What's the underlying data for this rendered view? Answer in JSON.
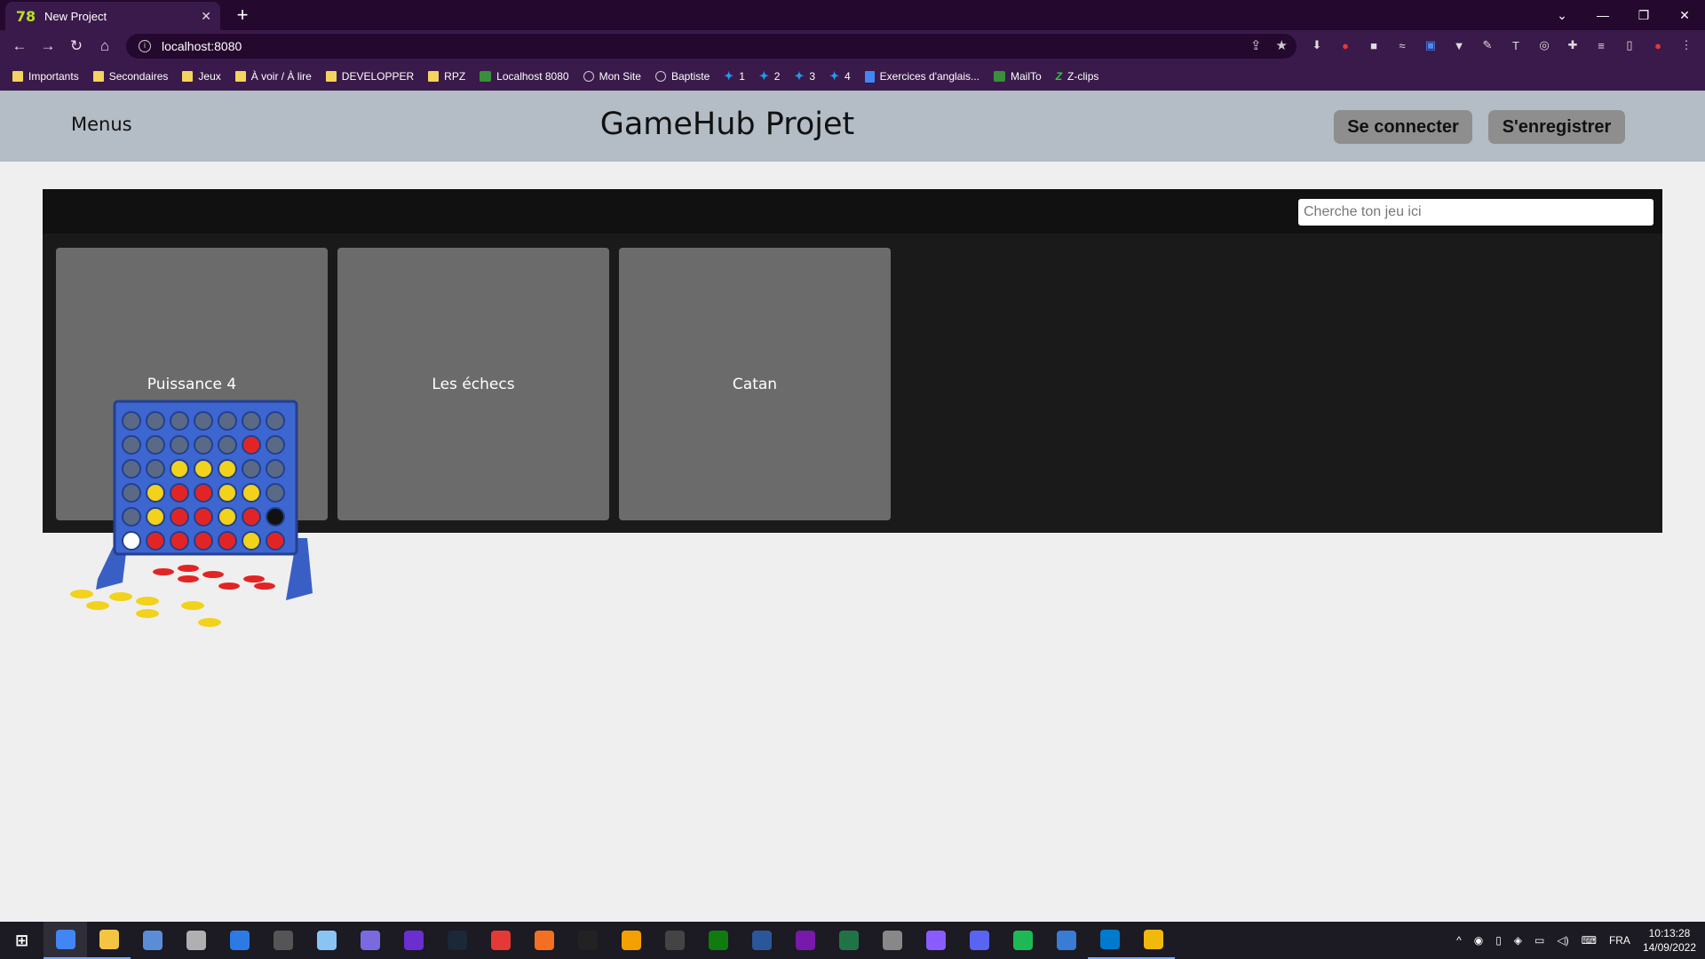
{
  "browser": {
    "tab_title": "New Project",
    "tab_favicon_text": "78",
    "url": "localhost:8080",
    "bookmarks": [
      {
        "label": "Importants",
        "icon": "folder-icon"
      },
      {
        "label": "Secondaires",
        "icon": "folder-icon"
      },
      {
        "label": "Jeux",
        "icon": "folder-icon"
      },
      {
        "label": "À voir / À lire",
        "icon": "folder-icon"
      },
      {
        "label": "DEVELOPPER",
        "icon": "folder-icon"
      },
      {
        "label": "RPZ",
        "icon": "folder-icon"
      },
      {
        "label": "Localhost 8080",
        "icon": "image-icon"
      },
      {
        "label": "Mon Site",
        "icon": "globe-icon"
      },
      {
        "label": "Baptiste",
        "icon": "globe-icon"
      },
      {
        "label": "1",
        "icon": "twitter-icon"
      },
      {
        "label": "2",
        "icon": "twitter-icon"
      },
      {
        "label": "3",
        "icon": "twitter-icon"
      },
      {
        "label": "4",
        "icon": "twitter-icon"
      },
      {
        "label": "Exercices d'anglais...",
        "icon": "document-icon"
      },
      {
        "label": "MailTo",
        "icon": "image-icon"
      },
      {
        "label": "Z-clips",
        "icon": "z-icon"
      }
    ]
  },
  "header": {
    "menus_label": "Menus",
    "title": "GameHub Projet",
    "login_label": "Se connecter",
    "register_label": "S'enregistrer"
  },
  "search": {
    "placeholder": "Cherche ton jeu ici"
  },
  "games": [
    {
      "name": "Puissance 4"
    },
    {
      "name": "Les échecs"
    },
    {
      "name": "Catan"
    }
  ],
  "taskbar": {
    "language": "FRA",
    "time": "10:13:28",
    "date": "14/09/2022",
    "apps": [
      "windows-start-icon",
      "chrome-icon",
      "file-explorer-icon",
      "photos-icon",
      "game-icon",
      "calculator-icon",
      "settings-icon",
      "notepad-icon",
      "controller-icon",
      "cortana-icon",
      "steam-icon",
      "ea-icon",
      "origin-icon",
      "epic-games-icon",
      "rockstar-icon",
      "ubisoft-icon",
      "xbox-icon",
      "word-icon",
      "onenote-icon",
      "excel-icon",
      "shield-icon",
      "messenger-icon",
      "discord-icon",
      "spotify-icon",
      "task-icon",
      "vscode-icon",
      "binance-icon"
    ]
  },
  "colors": {
    "chrome_bg": "#3a1a4a",
    "header_bg": "#b4bcc5",
    "panel_bg": "#1a1a1a",
    "card_bg": "#6b6b6b",
    "button_bg": "#8e8e8e"
  }
}
